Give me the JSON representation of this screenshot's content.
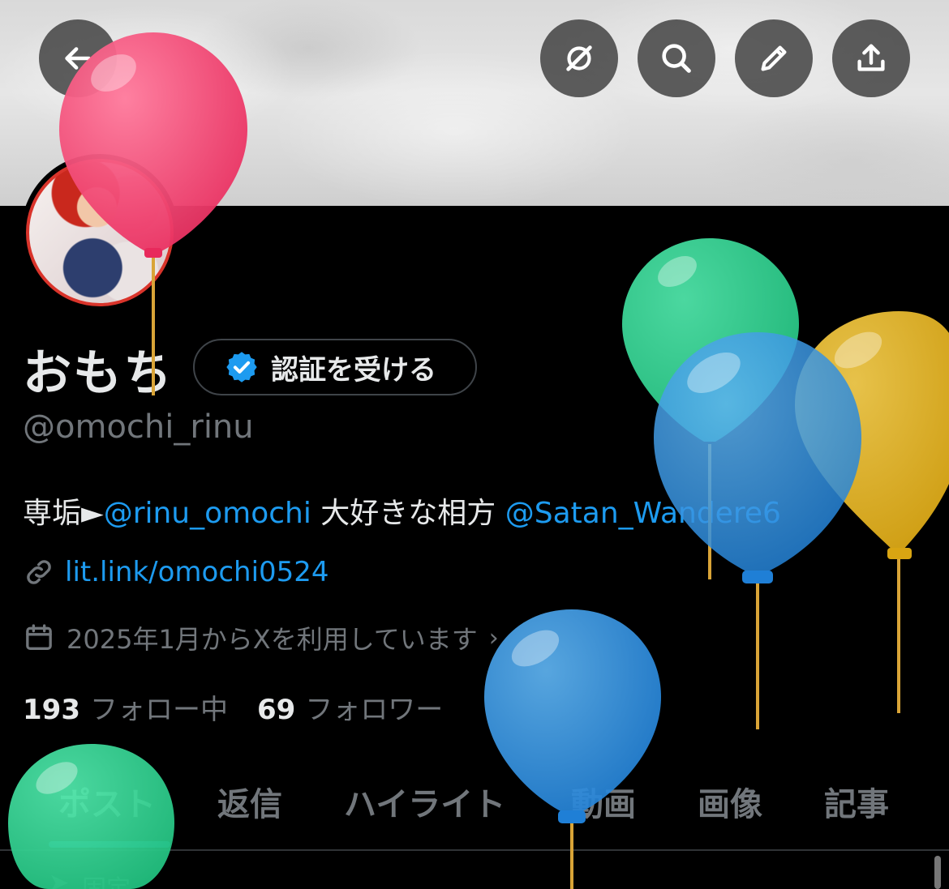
{
  "profile": {
    "name": "おもち",
    "handle": "@omochi_rinu",
    "verify_label": "認証を受ける",
    "bio": {
      "prefix": "専垢►",
      "mention1": "@rinu_omochi",
      "middle": " 大好きな相方 ",
      "mention2": "@Satan_Wandere6"
    },
    "link": "lit.link/omochi0524",
    "joined": "2025年1月からXを利用しています",
    "following_count": "193",
    "following_label": "フォロー中",
    "followers_count": "69",
    "followers_label": "フォロワー"
  },
  "tabs": [
    "ポスト",
    "返信",
    "ハイライト",
    "動画",
    "画像",
    "記事"
  ],
  "partial_row_text": "固定",
  "icons": {
    "back": "arrow-left-icon",
    "grok": "grok-icon",
    "search": "search-icon",
    "edit": "pencil-icon",
    "share": "share-icon",
    "verified": "verified-badge-icon",
    "link": "link-icon",
    "calendar": "calendar-icon"
  },
  "colors": {
    "accent": "#1d9bf0",
    "background": "#000000",
    "text_primary": "#e7e9ea",
    "text_secondary": "#71767b",
    "avatar_ring": "#d9342b",
    "balloon_pink": "#ec3a6a",
    "balloon_green": "#2fd08f",
    "balloon_blue": "#2f8fdd",
    "balloon_yellow": "#e2b020"
  }
}
